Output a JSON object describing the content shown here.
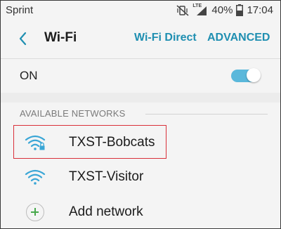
{
  "status": {
    "carrier": "Sprint",
    "lte": "LTE",
    "battery": "40%",
    "time": "17:04",
    "icons": [
      "mute-vibrate-icon",
      "lte-signal-icon",
      "battery-icon"
    ]
  },
  "header": {
    "title": "Wi-Fi",
    "wifi_direct_label": "Wi-Fi Direct",
    "advanced_label": "ADVANCED",
    "back_icon": "back-arrow-icon"
  },
  "toggle_row": {
    "label": "ON",
    "enabled": true
  },
  "networks": {
    "section_title": "AVAILABLE NETWORKS",
    "items": [
      {
        "name": "TXST-Bobcats",
        "icon": "wifi-locked-icon",
        "secured": true,
        "highlighted": true
      },
      {
        "name": "TXST-Visitor",
        "icon": "wifi-icon",
        "secured": false,
        "highlighted": false
      }
    ],
    "add_label": "Add network"
  },
  "colors": {
    "accent": "#1f8fb1",
    "toggle": "#5ab8db",
    "highlight_border": "#d9303a",
    "add_plus": "#47a84b"
  }
}
